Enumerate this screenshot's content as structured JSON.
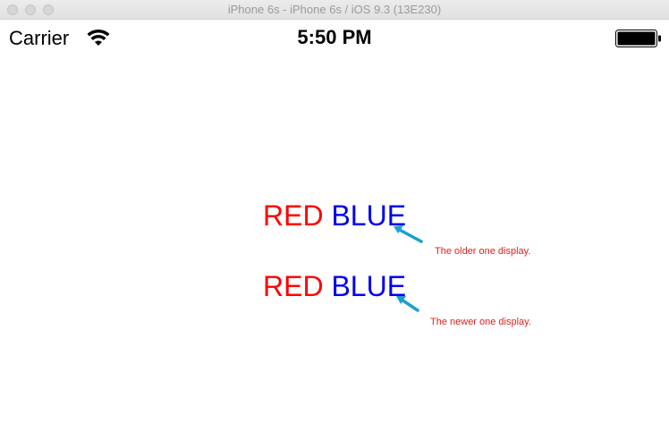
{
  "window": {
    "title": "iPhone 6s - iPhone 6s / iOS 9.3 (13E230)"
  },
  "status_bar": {
    "carrier": "Carrier",
    "time": "5:50 PM",
    "icons": [
      "wifi-icon",
      "battery-icon"
    ]
  },
  "content": {
    "older": {
      "red_text": "RED",
      "blue_text": "BLUE",
      "annotation": "The older one display."
    },
    "newer": {
      "red_text": "RED",
      "blue_text": "BLUE",
      "annotation": "The newer one display."
    }
  },
  "colors": {
    "red": "#ff0000",
    "blue": "#0000ee",
    "annotation": "#e02020",
    "arrow": "#1a9fd0"
  }
}
